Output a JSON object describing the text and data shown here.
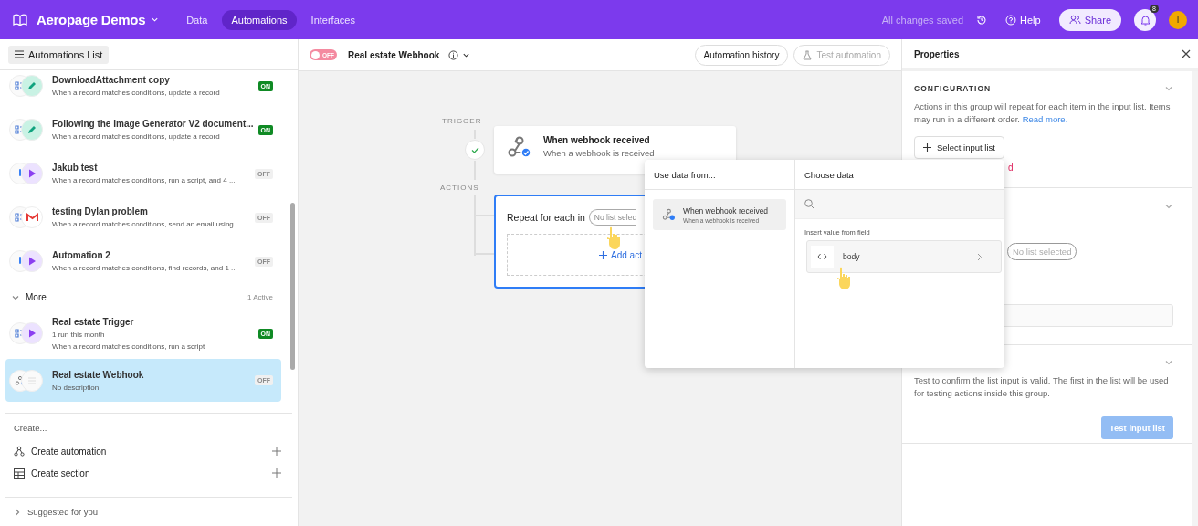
{
  "app": {
    "title": "Aeropage Demos",
    "nav": [
      {
        "label": "Data",
        "selected": false
      },
      {
        "label": "Automations",
        "selected": true
      },
      {
        "label": "Interfaces",
        "selected": false
      }
    ],
    "save_status": "All changes saved",
    "help": "Help",
    "share": "Share",
    "notifications": "8",
    "avatar": "T"
  },
  "sidebar": {
    "header": "Automations List",
    "items": [
      {
        "title": "DownloadAttachment copy",
        "description": "When a record matches conditions, update a record",
        "icons": [
          {
            "kind": "record"
          },
          {
            "kind": "pencil"
          }
        ],
        "status": {
          "label": "ON",
          "on": true
        },
        "selected": false
      },
      {
        "title": "Following the Image Generator V2 document...",
        "description": "When a record matches conditions, update a record",
        "icons": [
          {
            "kind": "record"
          },
          {
            "kind": "pencil"
          }
        ],
        "status": {
          "label": "ON",
          "on": true
        },
        "selected": false
      },
      {
        "title": "Jakub test",
        "description": "When a record matches conditions, run a script, and 4 ...",
        "icons": [
          {
            "kind": "button"
          },
          {
            "kind": "play"
          }
        ],
        "status": {
          "label": "OFF",
          "on": false
        },
        "selected": false
      },
      {
        "title": "testing Dylan problem",
        "description": "When a record matches conditions, send an email using...",
        "icons": [
          {
            "kind": "record"
          },
          {
            "kind": "gmail"
          }
        ],
        "status": {
          "label": "OFF",
          "on": false
        },
        "selected": false
      },
      {
        "title": "Automation 2",
        "description": "When a record matches conditions, find records, and 1 ...",
        "icons": [
          {
            "kind": "button"
          },
          {
            "kind": "play"
          }
        ],
        "status": {
          "label": "OFF",
          "on": false
        },
        "selected": false
      }
    ],
    "more": {
      "label": "More",
      "expanded": true,
      "count": "1 Active"
    },
    "more_items": [
      {
        "title": "Real estate Trigger",
        "run_info": "1 run this month",
        "description": "When a record matches conditions, run a script",
        "icons": [
          {
            "kind": "record"
          },
          {
            "kind": "play"
          }
        ],
        "status": {
          "label": "ON",
          "on": true
        },
        "selected": false
      },
      {
        "title": "Real estate Webhook",
        "description": "No description",
        "icons": [
          {
            "kind": "webhook"
          },
          {
            "kind": "list"
          }
        ],
        "status": {
          "label": "OFF",
          "on": false
        },
        "selected": true
      }
    ],
    "create": {
      "label": "Create...",
      "items": [
        {
          "label": "Create automation",
          "kind": "automation"
        },
        {
          "label": "Create section",
          "kind": "table"
        }
      ]
    },
    "suggested": {
      "label": "Suggested for you",
      "expanded": false
    }
  },
  "canvas": {
    "automation": {
      "name": "Real estate Webhook",
      "toggle_label": "OFF",
      "enabled": false
    },
    "history_button": "Automation history",
    "test_button": {
      "label": "Test automation",
      "disabled": true
    },
    "trigger_label": "TRIGGER",
    "actions_label": "ACTIONS",
    "trigger": {
      "title": "When webhook received",
      "subtitle": "When a webhook is received",
      "completed": true
    },
    "repeat": {
      "label": "Repeat for each in",
      "list_chip": "No list selec",
      "add_action": "Add act",
      "selected": true
    }
  },
  "popup": {
    "left_title": "Use data from...",
    "sources": [
      {
        "title": "When webhook received",
        "subtitle": "When a webhook is received",
        "selected": true
      }
    ],
    "right_title": "Choose data",
    "section_label": "Insert value from field",
    "fields": [
      {
        "name": "body"
      }
    ]
  },
  "properties": {
    "title": "Properties",
    "configuration": {
      "heading": "CONFIGURATION",
      "expanded": true,
      "description": "Actions in this group will repeat for each item in the input list. Items may run in a different order.",
      "link": "Read more.",
      "select_button": "Select input list",
      "error": "d"
    },
    "list_section": {
      "expanded": true,
      "chip": "No list selected"
    },
    "test_section": {
      "expanded": true,
      "description": "Test to confirm the list input is valid. The first in the list will be used for testing actions inside this group.",
      "button": {
        "label": "Test input list",
        "disabled": true
      }
    }
  }
}
